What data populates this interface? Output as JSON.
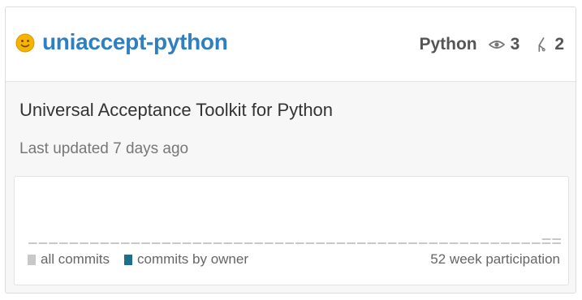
{
  "repo": {
    "name": "uniaccept-python",
    "icon": "smiley-face-icon",
    "language": "Python",
    "watchers": "3",
    "forks": "2",
    "description": "Universal Acceptance Toolkit for Python",
    "updated": "Last updated 7 days ago"
  },
  "participation": {
    "legend_all": "all commits",
    "legend_owner": "commits by owner",
    "label": "52 week participation",
    "weeks": 52,
    "colors": {
      "all": "#c8c8c8",
      "owner": "#1f6f8b"
    }
  },
  "colors": {
    "title": "#2f7fc1",
    "icon_yellow": "#f5b400"
  }
}
